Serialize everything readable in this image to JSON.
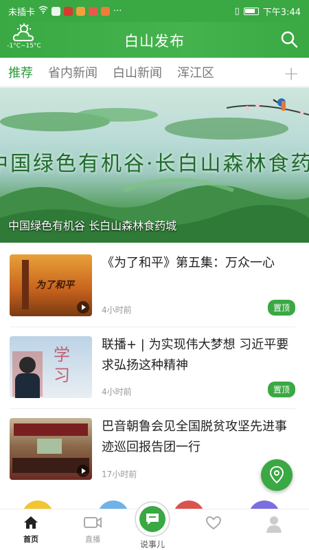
{
  "statusbar": {
    "carrier": "未插卡",
    "time": "下午3:44"
  },
  "header": {
    "weather_temp": "-1°C~15°C",
    "title": "白山发布"
  },
  "tabs": [
    "推荐",
    "省内新闻",
    "白山新闻",
    "浑江区"
  ],
  "tab_add": "+",
  "banner": {
    "title": "中国绿色有机谷·长白山森林食药城",
    "caption": "中国绿色有机谷 长白山森林食药城"
  },
  "news": [
    {
      "headline": "《为了和平》第五集：万众一心",
      "time": "4小时前",
      "badge": "置顶",
      "thumb_text": "为了和平"
    },
    {
      "headline": "联播+ | 为实现伟大梦想 习近平要求弘扬这种精神",
      "time": "4小时前",
      "badge": "置顶",
      "thumb_text": "学习"
    },
    {
      "headline": "巴音朝鲁会见全国脱贫攻坚先进事迹巡回报告团一行",
      "time": "17小时前",
      "badge": ""
    }
  ],
  "bottomnav": {
    "home": "首页",
    "live": "直播",
    "talk": "说事儿"
  },
  "colors": {
    "brand": "#3aa843",
    "pin": "#3aa843"
  }
}
